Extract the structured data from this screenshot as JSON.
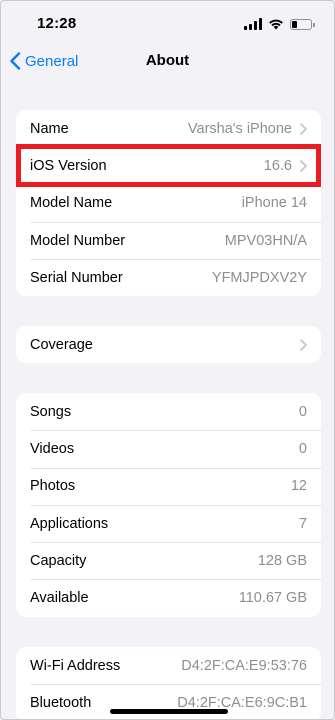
{
  "status_bar": {
    "time": "12:28",
    "icons": [
      "cellular-signal-icon",
      "wifi-icon",
      "battery-icon"
    ],
    "battery_level": 0.25
  },
  "nav": {
    "back_label": "General",
    "title": "About"
  },
  "group1": [
    {
      "label": "Name",
      "value": "Varsha's iPhone",
      "chevron": true
    },
    {
      "label": "iOS Version",
      "value": "16.6",
      "chevron": true
    },
    {
      "label": "Model Name",
      "value": "iPhone 14",
      "chevron": false
    },
    {
      "label": "Model Number",
      "value": "MPV03HN/A",
      "chevron": false
    },
    {
      "label": "Serial Number",
      "value": "YFMJPDXV2Y",
      "chevron": false
    }
  ],
  "group2": [
    {
      "label": "Coverage",
      "value": "",
      "chevron": true
    }
  ],
  "group3": [
    {
      "label": "Songs",
      "value": "0"
    },
    {
      "label": "Videos",
      "value": "0"
    },
    {
      "label": "Photos",
      "value": "12"
    },
    {
      "label": "Applications",
      "value": "7"
    },
    {
      "label": "Capacity",
      "value": "128 GB"
    },
    {
      "label": "Available",
      "value": "110.67 GB"
    }
  ],
  "group4": [
    {
      "label": "Wi-Fi Address",
      "value": "D4:2F:CA:E9:53:76"
    },
    {
      "label": "Bluetooth",
      "value": "D4:2F:CA:E6:9C:B1"
    }
  ],
  "colors": {
    "accent": "#0a7aff",
    "background": "#f2f2f7",
    "secondary_text": "#8e8e93",
    "highlight": "#ea1d25"
  }
}
